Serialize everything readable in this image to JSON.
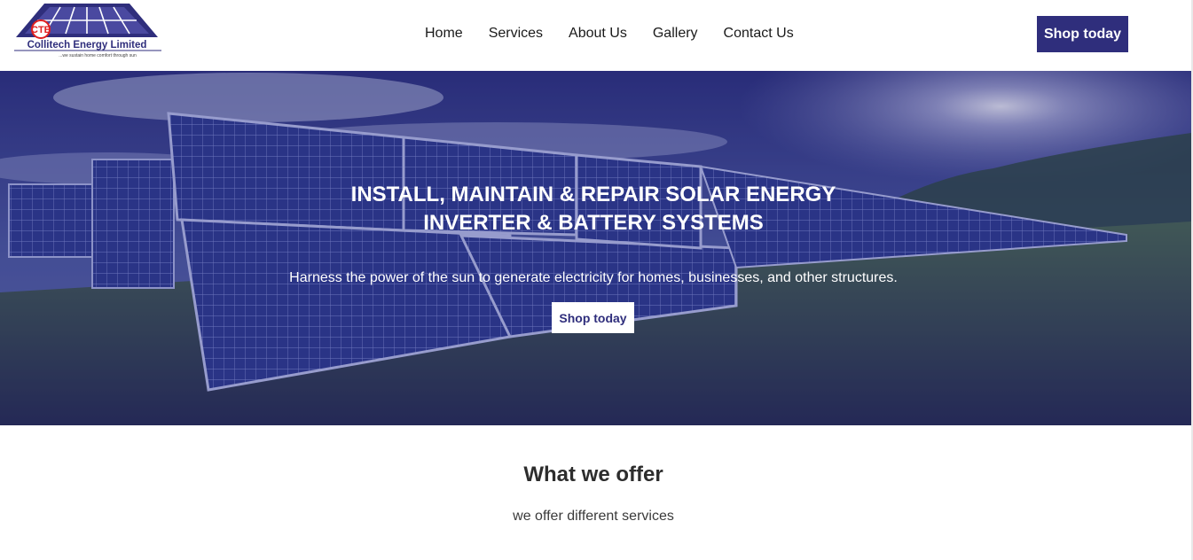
{
  "brand": {
    "logo_letters": "CTE",
    "company_name": "Collitech Energy Limited",
    "tagline": "...we sustain home comfort through sun"
  },
  "nav": {
    "links": [
      "Home",
      "Services",
      "About Us",
      "Gallery",
      "Contact Us"
    ],
    "cta_label": "Shop today"
  },
  "hero": {
    "title_line1": "INSTALL, MAINTAIN & REPAIR SOLAR ENERGY",
    "title_line2": "INVERTER & BATTERY  SYSTEMS",
    "subtitle": "Harness the power of the sun to generate electricity for homes, businesses, and other structures.",
    "cta_label": "Shop today",
    "image": "solar-panels-field-photo"
  },
  "offer": {
    "title": "What we offer",
    "subtitle": "we offer different services"
  },
  "colors": {
    "brand_primary": "#2f2e7c",
    "logo_red": "#e02020",
    "text_dark": "#2d2d2d",
    "white": "#ffffff"
  }
}
